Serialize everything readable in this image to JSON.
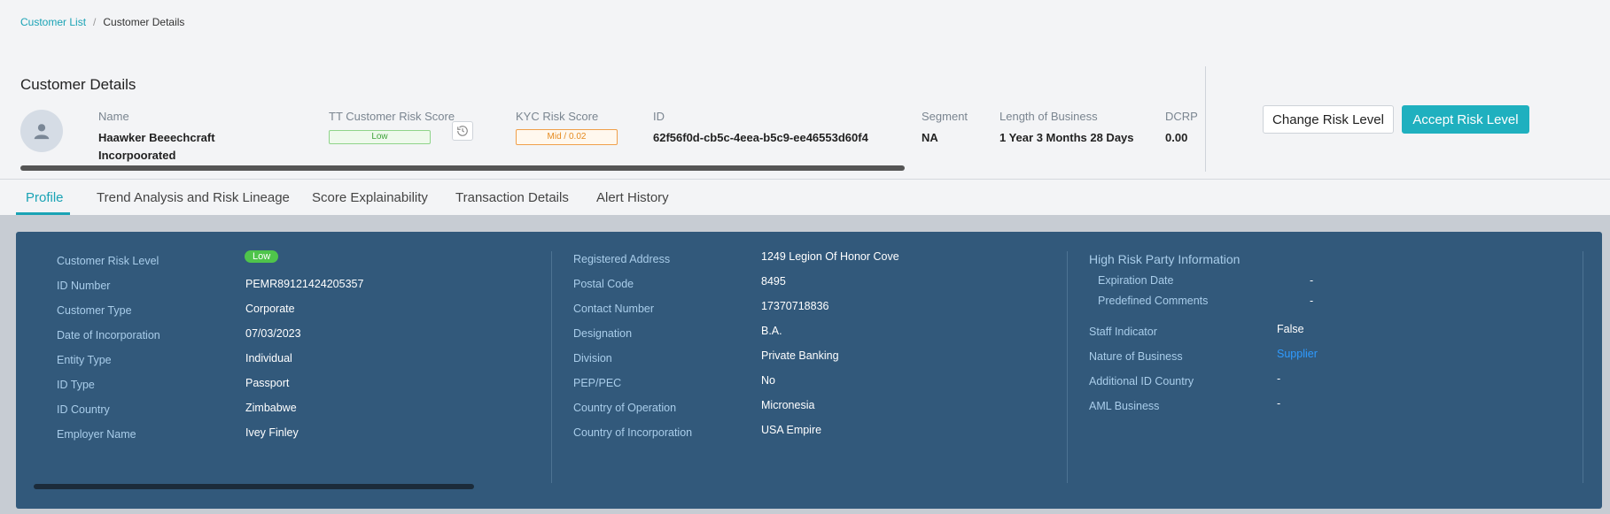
{
  "breadcrumb": {
    "parent": "Customer List",
    "separator": "/",
    "current": "Customer Details"
  },
  "page_title": "Customer Details",
  "summary": {
    "name": {
      "label": "Name",
      "line1": "Haawker Beeechcraft",
      "line2": "Incorpoorated"
    },
    "tt_risk": {
      "label": "TT Customer Risk Score",
      "value": "Low"
    },
    "kyc_risk": {
      "label": "KYC Risk Score",
      "value": "Mid / 0.02"
    },
    "id": {
      "label": "ID",
      "value": "62f56f0d-cb5c-4eea-b5c9-ee46553d60f4"
    },
    "segment": {
      "label": "Segment",
      "value": "NA"
    },
    "length_of_business": {
      "label": "Length of Business",
      "value": "1 Year 3 Months 28 Days"
    },
    "dcrp": {
      "label": "DCRP",
      "value": "0.00"
    }
  },
  "actions": {
    "change_label": "Change Risk Level",
    "accept_label": "Accept Risk Level"
  },
  "tabs": [
    {
      "label": "Profile",
      "active": true
    },
    {
      "label": "Trend Analysis and Risk Lineage",
      "active": false
    },
    {
      "label": "Score Explainability",
      "active": false
    },
    {
      "label": "Transaction Details",
      "active": false
    },
    {
      "label": "Alert History",
      "active": false
    }
  ],
  "profile": {
    "col1": [
      {
        "label": "Customer Risk Level",
        "value": "Low"
      },
      {
        "label": "ID Number",
        "value": "PEMR89121424205357"
      },
      {
        "label": "Customer Type",
        "value": "Corporate"
      },
      {
        "label": "Date of Incorporation",
        "value": "07/03/2023"
      },
      {
        "label": "Entity Type",
        "value": "Individual"
      },
      {
        "label": "ID Type",
        "value": "Passport"
      },
      {
        "label": "ID Country",
        "value": "Zimbabwe"
      },
      {
        "label": "Employer Name",
        "value": "Ivey Finley"
      }
    ],
    "col2": [
      {
        "label": "Registered Address",
        "value": "1249 Legion Of Honor Cove"
      },
      {
        "label": "Postal Code",
        "value": "8495"
      },
      {
        "label": "Contact Number",
        "value": "17370718836"
      },
      {
        "label": "Designation",
        "value": "B.A."
      },
      {
        "label": "Division",
        "value": "Private Banking"
      },
      {
        "label": "PEP/PEC",
        "value": "No"
      },
      {
        "label": "Country of Operation",
        "value": "Micronesia"
      },
      {
        "label": "Country of Incorporation",
        "value": "USA Empire"
      }
    ],
    "col3": {
      "section_title": "High Risk Party Information",
      "sub": [
        {
          "label": "Expiration Date",
          "value": "-"
        },
        {
          "label": "Predefined Comments",
          "value": "-"
        }
      ],
      "items": [
        {
          "label": "Staff Indicator",
          "value": "False"
        },
        {
          "label": "Nature of Business",
          "value": "Supplier"
        },
        {
          "label": "Additional ID Country",
          "value": "-"
        },
        {
          "label": "AML Business",
          "value": "-"
        }
      ]
    }
  },
  "colors": {
    "accent": "#1fb0bf",
    "panel": "#32597b",
    "low_badge": "#4fc44b",
    "mid_badge": "#e58a1f"
  }
}
